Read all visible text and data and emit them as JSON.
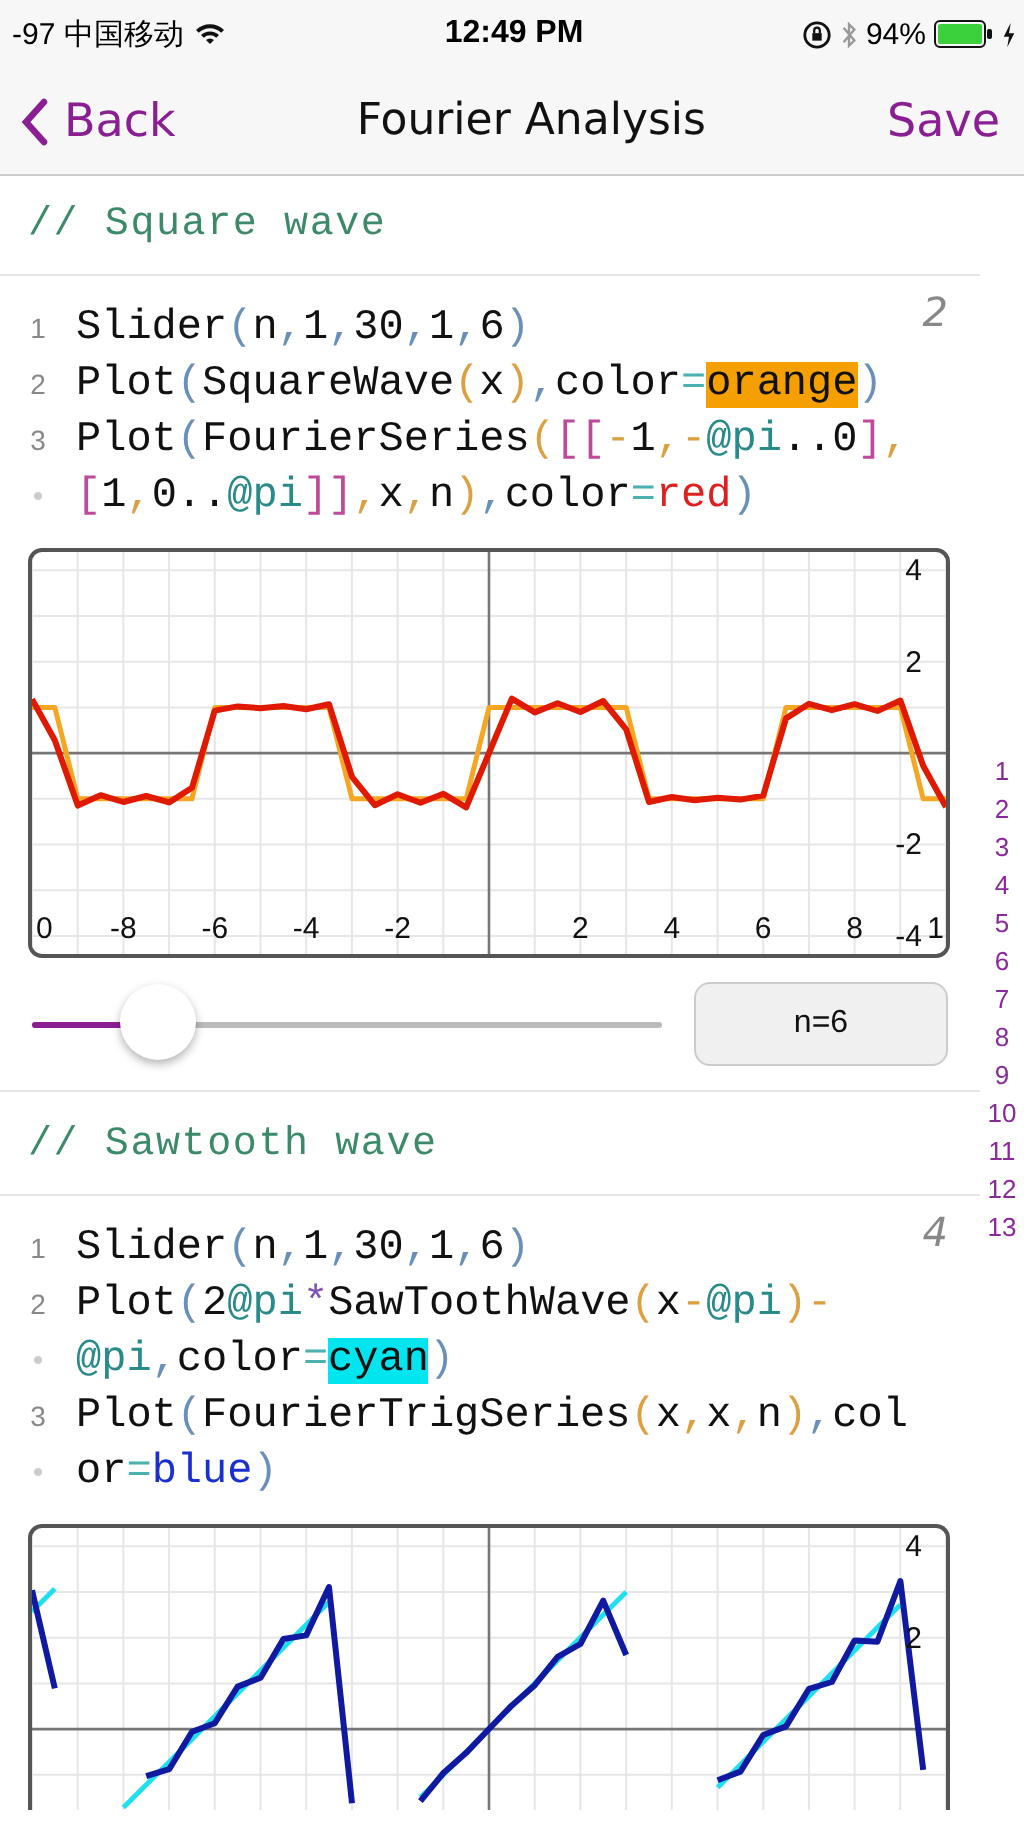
{
  "status_bar": {
    "carrier": "-97 中国移动",
    "time": "12:49 PM",
    "battery": "94%"
  },
  "nav": {
    "back": "Back",
    "title": "Fourier Analysis",
    "action": "Save"
  },
  "cells": [
    {
      "comment": "// Square wave",
      "result": "2",
      "lines": [
        {
          "continued": false,
          "number": "1",
          "tokens": [
            {
              "text": "Slider",
              "kind": "plain"
            },
            {
              "text": "(",
              "kind": "paren"
            },
            {
              "text": "n",
              "kind": "plain"
            },
            {
              "text": ",",
              "kind": "paren"
            },
            {
              "text": "1",
              "kind": "plain"
            },
            {
              "text": ",",
              "kind": "paren"
            },
            {
              "text": "30",
              "kind": "plain"
            },
            {
              "text": ",",
              "kind": "paren"
            },
            {
              "text": "1",
              "kind": "plain"
            },
            {
              "text": ",",
              "kind": "paren"
            },
            {
              "text": "6",
              "kind": "plain"
            },
            {
              "text": ")",
              "kind": "paren"
            }
          ]
        },
        {
          "continued": false,
          "number": "2",
          "tokens": [
            {
              "text": "Plot",
              "kind": "plain"
            },
            {
              "text": "(",
              "kind": "paren"
            },
            {
              "text": "SquareWave",
              "kind": "plain"
            },
            {
              "text": "(",
              "kind": "paren2"
            },
            {
              "text": "x",
              "kind": "plain"
            },
            {
              "text": ")",
              "kind": "paren2"
            },
            {
              "text": ",",
              "kind": "paren"
            },
            {
              "text": "color",
              "kind": "plain"
            },
            {
              "text": "=",
              "kind": "op"
            },
            {
              "text": "orange",
              "kind": "mark",
              "color": "#f5a000"
            },
            {
              "text": ")",
              "kind": "paren"
            }
          ]
        },
        {
          "continued": false,
          "number": "3",
          "tokens": [
            {
              "text": "Plot",
              "kind": "plain"
            },
            {
              "text": "(",
              "kind": "paren"
            },
            {
              "text": "FourierSeries",
              "kind": "plain"
            },
            {
              "text": "(",
              "kind": "paren2"
            },
            {
              "text": "[[",
              "kind": "bracket"
            },
            {
              "text": "-",
              "kind": "paren2"
            },
            {
              "text": "1",
              "kind": "plain"
            },
            {
              "text": ",",
              "kind": "paren2"
            },
            {
              "text": "-",
              "kind": "paren2"
            },
            {
              "text": "@pi",
              "kind": "pi"
            },
            {
              "text": "..0",
              "kind": "plain"
            },
            {
              "text": "]",
              "kind": "bracket"
            },
            {
              "text": ",",
              "kind": "paren2"
            }
          ]
        },
        {
          "continued": true,
          "tokens": [
            {
              "text": "[",
              "kind": "bracket"
            },
            {
              "text": "1",
              "kind": "plain"
            },
            {
              "text": ",",
              "kind": "paren2"
            },
            {
              "text": "0..",
              "kind": "plain"
            },
            {
              "text": "@pi",
              "kind": "pi"
            },
            {
              "text": "]]",
              "kind": "bracket"
            },
            {
              "text": ",",
              "kind": "paren2"
            },
            {
              "text": "x",
              "kind": "plain"
            },
            {
              "text": ",",
              "kind": "paren2"
            },
            {
              "text": "n",
              "kind": "plain"
            },
            {
              "text": ")",
              "kind": "paren2"
            },
            {
              "text": ",",
              "kind": "paren"
            },
            {
              "text": "color",
              "kind": "plain"
            },
            {
              "text": "=",
              "kind": "op"
            },
            {
              "text": "red",
              "kind": "word",
              "color": "#e02020"
            },
            {
              "text": ")",
              "kind": "paren"
            }
          ]
        }
      ],
      "plot": {
        "full": true,
        "chart_data": {
          "type": "line",
          "x": [
            -10,
            -9.5,
            -9,
            -8.5,
            -8,
            -7.5,
            -7,
            -6.5,
            -6,
            -5.5,
            -5,
            -4.5,
            -4,
            -3.5,
            -3,
            -2.5,
            -2,
            -1.5,
            -1,
            -0.5,
            0,
            0.5,
            1,
            1.5,
            2,
            2.5,
            3,
            3.5,
            4,
            4.5,
            5,
            5.5,
            6,
            6.5,
            7,
            7.5,
            8,
            8.5,
            9,
            9.5,
            10
          ],
          "series": [
            {
              "color": "#f5a623",
              "values": [
                1,
                1,
                -1,
                -1,
                -1,
                -1,
                -1,
                -1,
                1,
                1,
                1,
                1,
                1,
                1,
                -1,
                -1,
                -1,
                -1,
                -1,
                -1,
                1,
                1,
                1,
                1,
                1,
                1,
                1,
                -1,
                -1,
                -1,
                -1,
                -1,
                -1,
                1,
                1,
                1,
                1,
                1,
                1,
                -1,
                -1
              ]
            },
            {
              "color": "#e01a00",
              "values": [
                1.18,
                0.28,
                -1.15,
                -0.92,
                -1.07,
                -0.94,
                -1.08,
                -0.76,
                0.93,
                1.02,
                0.98,
                1.03,
                0.96,
                1.07,
                -0.52,
                -1.14,
                -0.9,
                -1.09,
                -0.89,
                -1.19,
                0,
                1.19,
                0.89,
                1.09,
                0.9,
                1.14,
                0.52,
                -1.07,
                -0.96,
                -1.03,
                -0.98,
                -1.02,
                -0.93,
                0.76,
                1.08,
                0.94,
                1.07,
                0.92,
                1.15,
                -0.28,
                -1.18
              ]
            }
          ],
          "xlim": [
            -10,
            10
          ],
          "ylim": [
            -4.4,
            4.4
          ],
          "xticks": [
            -8,
            -6,
            -4,
            -2,
            2,
            4,
            6,
            8
          ],
          "yticks": [
            4,
            2,
            -2,
            -4
          ],
          "grid": true
        },
        "edge_labels": [
          "0",
          "1"
        ]
      },
      "slider": {
        "level": 0.2,
        "reading": "n=6"
      }
    },
    {
      "comment": "// Sawtooth wave",
      "result": "4",
      "lines": [
        {
          "continued": false,
          "number": "1",
          "tokens": [
            {
              "text": "Slider",
              "kind": "plain"
            },
            {
              "text": "(",
              "kind": "paren"
            },
            {
              "text": "n",
              "kind": "plain"
            },
            {
              "text": ",",
              "kind": "paren"
            },
            {
              "text": "1",
              "kind": "plain"
            },
            {
              "text": ",",
              "kind": "paren"
            },
            {
              "text": "30",
              "kind": "plain"
            },
            {
              "text": ",",
              "kind": "paren"
            },
            {
              "text": "1",
              "kind": "plain"
            },
            {
              "text": ",",
              "kind": "paren"
            },
            {
              "text": "6",
              "kind": "plain"
            },
            {
              "text": ")",
              "kind": "paren"
            }
          ]
        },
        {
          "continued": false,
          "number": "2",
          "tokens": [
            {
              "text": "Plot",
              "kind": "plain"
            },
            {
              "text": "(",
              "kind": "paren"
            },
            {
              "text": "2",
              "kind": "plain"
            },
            {
              "text": "@pi",
              "kind": "pi"
            },
            {
              "text": "*",
              "kind": "star"
            },
            {
              "text": "SawToothWave",
              "kind": "plain"
            },
            {
              "text": "(",
              "kind": "paren2"
            },
            {
              "text": "x",
              "kind": "plain"
            },
            {
              "text": "-",
              "kind": "paren2"
            },
            {
              "text": "@pi",
              "kind": "pi"
            },
            {
              "text": ")",
              "kind": "paren2"
            },
            {
              "text": "-",
              "kind": "paren2"
            }
          ]
        },
        {
          "continued": true,
          "tokens": [
            {
              "text": "@pi",
              "kind": "pi"
            },
            {
              "text": ",",
              "kind": "paren"
            },
            {
              "text": "color",
              "kind": "plain"
            },
            {
              "text": "=",
              "kind": "op"
            },
            {
              "text": "cyan",
              "kind": "mark",
              "color": "#00e5ee"
            },
            {
              "text": ")",
              "kind": "paren"
            }
          ]
        },
        {
          "continued": false,
          "number": "3",
          "tokens": [
            {
              "text": "Plot",
              "kind": "plain"
            },
            {
              "text": "(",
              "kind": "paren"
            },
            {
              "text": "FourierTrigSeries",
              "kind": "plain"
            },
            {
              "text": "(",
              "kind": "paren2"
            },
            {
              "text": "x",
              "kind": "plain"
            },
            {
              "text": ",",
              "kind": "paren2"
            },
            {
              "text": "x",
              "kind": "plain"
            },
            {
              "text": ",",
              "kind": "paren2"
            },
            {
              "text": "n",
              "kind": "plain"
            },
            {
              "text": ")",
              "kind": "paren2"
            },
            {
              "text": ",",
              "kind": "paren"
            },
            {
              "text": "col",
              "kind": "plain"
            }
          ]
        },
        {
          "continued": true,
          "tokens": [
            {
              "text": "or",
              "kind": "plain"
            },
            {
              "text": "=",
              "kind": "op"
            },
            {
              "text": "blue",
              "kind": "word",
              "color": "#1a2fd0"
            },
            {
              "text": ")",
              "kind": "paren"
            }
          ]
        }
      ],
      "plot": {
        "full": false,
        "chart_data": {
          "type": "line",
          "x": [
            -10,
            -9.5,
            -8,
            -7.5,
            -7,
            -6.5,
            -6,
            -5.5,
            -5,
            -4.5,
            -4,
            -3.5,
            -3,
            -1.5,
            -1,
            -0.5,
            0,
            0.5,
            1,
            1.5,
            2,
            2.5,
            3,
            5,
            5.5,
            6,
            6.5,
            7,
            7.5,
            8,
            8.5,
            9,
            9.5
          ],
          "series": [
            {
              "color": "#20e0f0",
              "values": [
                2.57,
                3.07,
                -1.72,
                -1.22,
                -0.72,
                -0.22,
                0.28,
                0.78,
                1.28,
                1.78,
                2.28,
                2.78,
                null,
                -1.5,
                -1,
                -0.5,
                0,
                0.5,
                1,
                1.5,
                2,
                2.5,
                3,
                -1.28,
                -0.78,
                -0.28,
                0.22,
                0.72,
                1.22,
                1.72,
                2.22,
                2.72,
                null
              ]
            },
            {
              "color": "#101aa0",
              "values": [
                3.04,
                0.89,
                null,
                -1.03,
                -0.88,
                -0.06,
                0.13,
                0.93,
                1.12,
                1.97,
                2.05,
                3.11,
                -1.62,
                -1.58,
                -0.96,
                -0.52,
                0,
                0.52,
                0.96,
                1.58,
                1.86,
                2.81,
                1.62,
                -1.12,
                -0.93,
                -0.13,
                0.06,
                0.88,
                1.03,
                1.94,
                1.91,
                3.24,
                -0.89
              ]
            }
          ],
          "xlim": [
            -10,
            10
          ],
          "ylim": [
            -1.75,
            4.4
          ],
          "yticks": [
            4,
            2
          ],
          "grid": true
        }
      }
    }
  ],
  "gutter": [
    "1",
    "2",
    "3",
    "4",
    "5",
    "6",
    "7",
    "8",
    "9",
    "10",
    "11",
    "12",
    "13"
  ]
}
